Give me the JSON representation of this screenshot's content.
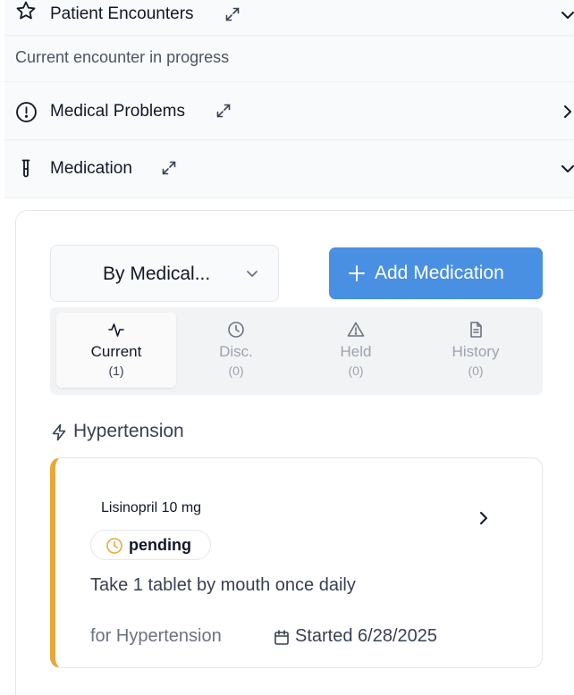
{
  "accordion": {
    "encounters": {
      "title": "Patient Encounters",
      "subtitle": "Current encounter in progress"
    },
    "problems": {
      "title": "Medical Problems"
    },
    "medication": {
      "title": "Medication"
    }
  },
  "medication_panel": {
    "sort_select": {
      "value": "By Medical..."
    },
    "add_button": {
      "label": "Add Medication"
    },
    "tabs": [
      {
        "label": "Current",
        "count": "(1)",
        "icon": "activity-icon",
        "active": true
      },
      {
        "label": "Disc.",
        "count": "(0)",
        "icon": "clock-icon"
      },
      {
        "label": "Held",
        "count": "(0)",
        "icon": "warning-icon"
      },
      {
        "label": "History",
        "count": "(0)",
        "icon": "document-icon"
      }
    ],
    "groups": [
      {
        "title": "Hypertension",
        "icon": "lightning-icon",
        "medications": [
          {
            "name": "Lisinopril 10 mg",
            "status": "pending",
            "sig": "Take 1 tablet by mouth once daily",
            "indication": "for Hypertension",
            "started": "Started 6/28/2025"
          }
        ]
      }
    ]
  },
  "colors": {
    "accent": "#4a90e2",
    "pending": "#e8a838",
    "section_bg": "#f9fafb"
  }
}
